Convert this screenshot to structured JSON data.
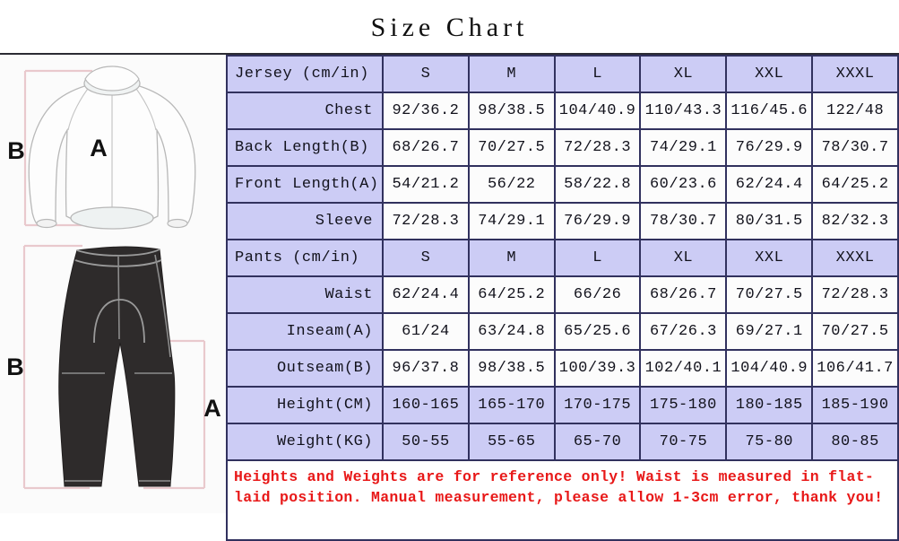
{
  "title": "Size Chart",
  "illustrations": {
    "jersey": {
      "name": "long-sleeve-cycling-jersey-diagram",
      "labels": {
        "back_length": "B",
        "front_length": "A"
      }
    },
    "pants": {
      "name": "cycling-pants-diagram",
      "labels": {
        "outseam": "B",
        "inseam": "A"
      }
    }
  },
  "table": {
    "rows": [
      {
        "type": "header",
        "label": "Jersey (cm/in)",
        "label_align": "left",
        "cells": [
          "S",
          "M",
          "L",
          "XL",
          "XXL",
          "XXXL"
        ]
      },
      {
        "type": "data",
        "label": "Chest",
        "label_align": "right",
        "cells": [
          "92/36.2",
          "98/38.5",
          "104/40.9",
          "110/43.3",
          "116/45.6",
          "122/48"
        ]
      },
      {
        "type": "data",
        "label": "Back Length(B)",
        "label_align": "left",
        "cells": [
          "68/26.7",
          "70/27.5",
          "72/28.3",
          "74/29.1",
          "76/29.9",
          "78/30.7"
        ]
      },
      {
        "type": "data",
        "label": "Front Length(A)",
        "label_align": "left",
        "cells": [
          "54/21.2",
          "56/22",
          "58/22.8",
          "60/23.6",
          "62/24.4",
          "64/25.2"
        ]
      },
      {
        "type": "data",
        "label": "Sleeve",
        "label_align": "right",
        "cells": [
          "72/28.3",
          "74/29.1",
          "76/29.9",
          "78/30.7",
          "80/31.5",
          "82/32.3"
        ]
      },
      {
        "type": "header",
        "label": "Pants (cm/in)",
        "label_align": "left",
        "cells": [
          "S",
          "M",
          "L",
          "XL",
          "XXL",
          "XXXL"
        ]
      },
      {
        "type": "data",
        "label": "Waist",
        "label_align": "right",
        "cells": [
          "62/24.4",
          "64/25.2",
          "66/26",
          "68/26.7",
          "70/27.5",
          "72/28.3"
        ]
      },
      {
        "type": "data",
        "label": "Inseam(A)",
        "label_align": "right",
        "cells": [
          "61/24",
          "63/24.8",
          "65/25.6",
          "67/26.3",
          "69/27.1",
          "70/27.5"
        ]
      },
      {
        "type": "data",
        "label": "Outseam(B)",
        "label_align": "right",
        "cells": [
          "96/37.8",
          "98/38.5",
          "100/39.3",
          "102/40.1",
          "104/40.9",
          "106/41.7"
        ]
      },
      {
        "type": "shaded",
        "label": "Height(CM)",
        "label_align": "right",
        "cells": [
          "160-165",
          "165-170",
          "170-175",
          "175-180",
          "180-185",
          "185-190"
        ]
      },
      {
        "type": "shaded",
        "label": "Weight(KG)",
        "label_align": "right",
        "cells": [
          "50-55",
          "55-65",
          "65-70",
          "70-75",
          "75-80",
          "80-85"
        ]
      }
    ],
    "note": "Heights and Weights are for reference only! Waist is measured in flat-laid position. Manual measurement, please allow 1-3cm error, thank you!"
  },
  "colors": {
    "header_fill": "#ccccf5",
    "cell_fill": "#fcfcfc",
    "border": "#31315e",
    "note_text": "#e81818",
    "bracket": "#e9c9cd",
    "pants_fill": "#2e2b2b"
  }
}
